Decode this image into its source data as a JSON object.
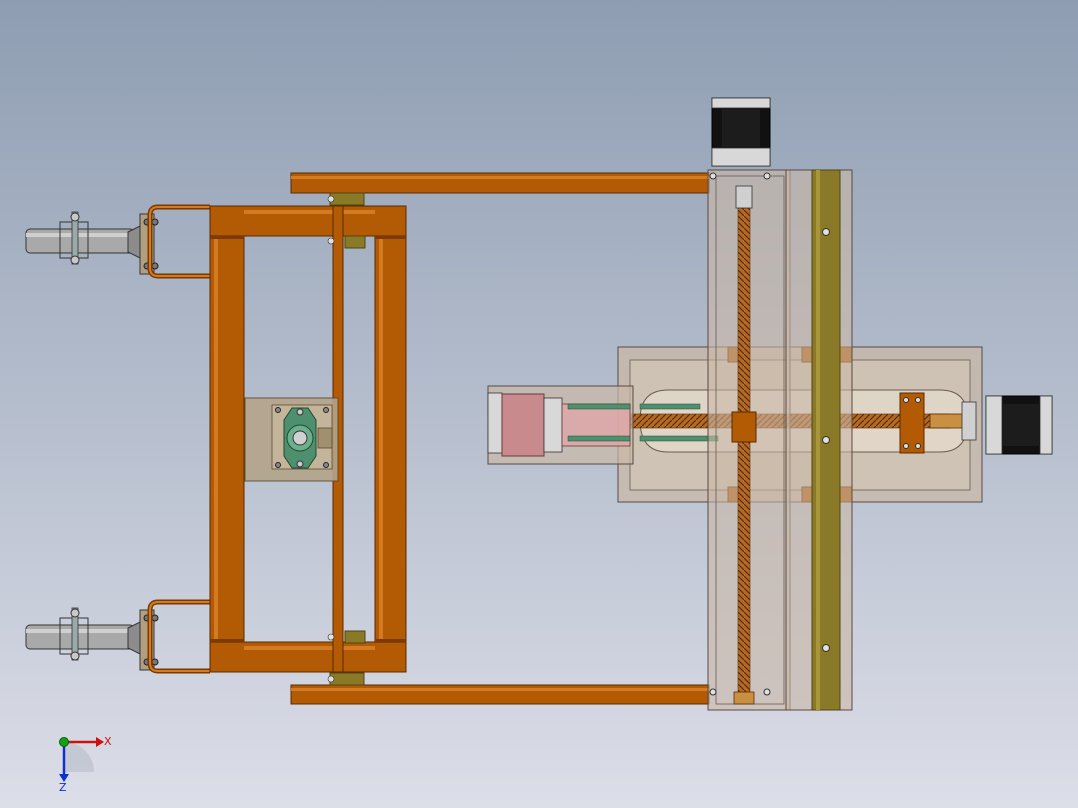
{
  "viewport": {
    "background_top": "#8E9DB2",
    "background_bottom": "#DCDEE8"
  },
  "colors": {
    "frame_orange": "#B35A05",
    "frame_edge": "#5A2A00",
    "frame_highlight": "#D47A20",
    "rail_olive": "#8A7A28",
    "rail_olive_edge": "#4E4510",
    "motor_black": "#111111",
    "motor_face": "#D8D8D8",
    "gantry_glass": "#C9B8A6",
    "screw_copper": "#B46A25",
    "bearing_green": "#4E8F6E",
    "gripper_pink": "#C98A8E",
    "wheel_gray": "#A9A9A9",
    "axis_x": "#D01010",
    "axis_y": "#10A010",
    "axis_z": "#1030D0"
  },
  "triad": {
    "x_label": "X",
    "z_label": "Z"
  }
}
